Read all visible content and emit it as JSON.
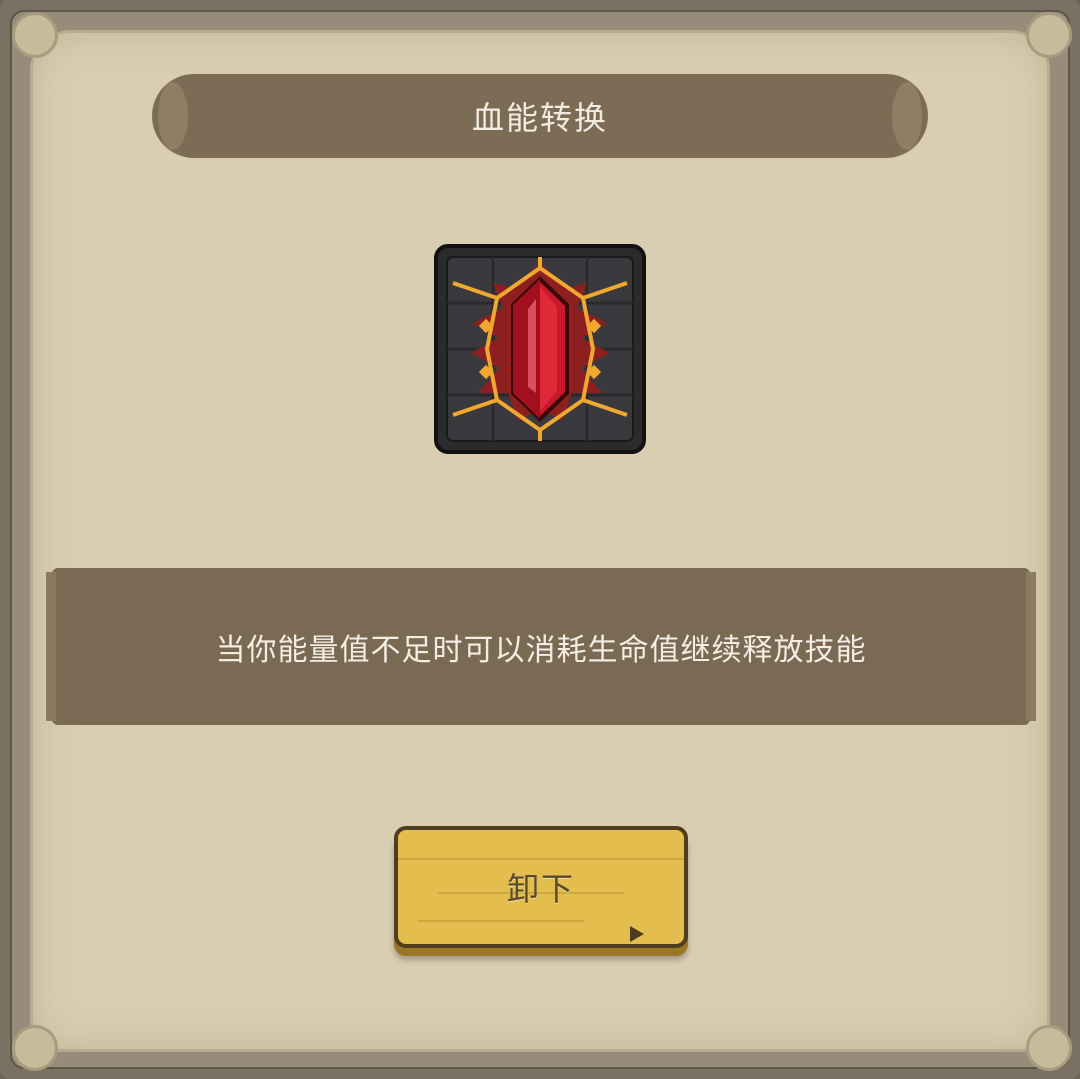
{
  "dialog": {
    "title": "血能转换",
    "description": "当你能量值不足时可以消耗生命值继续释放技能",
    "skill_icon": "red-crystal-icon",
    "unequip_label": "卸下"
  },
  "colors": {
    "parchment": "#d9ceb1",
    "banner": "#7d6c55",
    "button": "#e3bd4d",
    "crystal": "#c8192b",
    "rune_glow": "#f0a830"
  }
}
